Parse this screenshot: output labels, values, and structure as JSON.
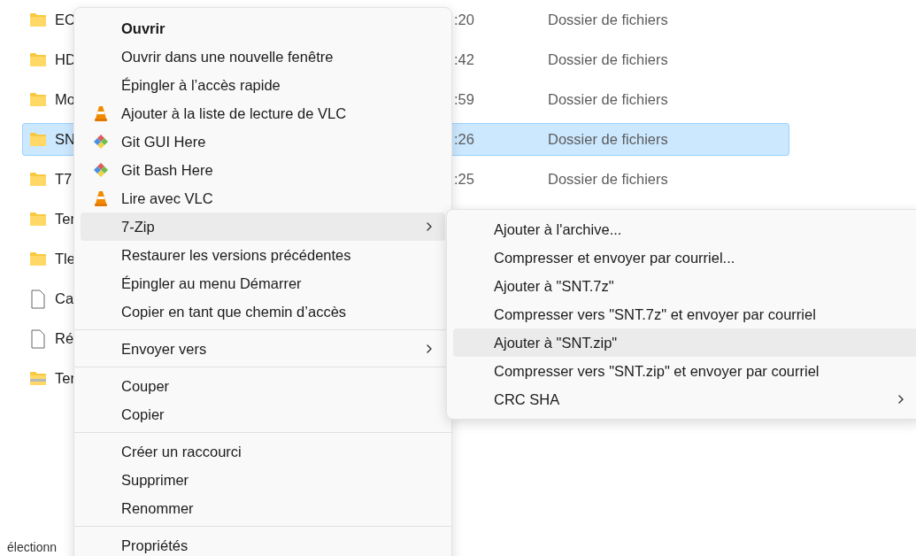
{
  "files": [
    {
      "name": "EC",
      "kind": "folder",
      "date": ":20",
      "type": "Dossier de fichiers",
      "selected": false
    },
    {
      "name": "HD",
      "kind": "folder",
      "date": ":42",
      "type": "Dossier de fichiers",
      "selected": false
    },
    {
      "name": "Mo",
      "kind": "folder",
      "date": ":59",
      "type": "Dossier de fichiers",
      "selected": false
    },
    {
      "name": "SN",
      "kind": "folder",
      "date": ":26",
      "type": "Dossier de fichiers",
      "selected": true
    },
    {
      "name": "T7",
      "kind": "folder",
      "date": ":25",
      "type": "Dossier de fichiers",
      "selected": false
    },
    {
      "name": "Ter",
      "kind": "folder",
      "selected": false
    },
    {
      "name": "Tle",
      "kind": "folder",
      "selected": false
    },
    {
      "name": "Ca",
      "kind": "file",
      "selected": false
    },
    {
      "name": "Ré",
      "kind": "file",
      "selected": false
    },
    {
      "name": "Ter",
      "kind": "zip",
      "selected": false
    }
  ],
  "status_bar": {
    "text": "électionn"
  },
  "context_menu": {
    "items": [
      {
        "kind": "plain",
        "label": "Ouvrir",
        "bold": true,
        "selected": false
      },
      {
        "kind": "plain",
        "label": "Ouvrir dans une nouvelle fenêtre",
        "selected": false
      },
      {
        "kind": "plain",
        "label": "Épingler à l’accès rapide",
        "selected": false
      },
      {
        "kind": "vlc",
        "label": "Ajouter à la liste de lecture de VLC",
        "selected": false
      },
      {
        "kind": "git",
        "label": "Git GUI Here",
        "selected": false
      },
      {
        "kind": "git",
        "label": "Git Bash Here",
        "selected": false
      },
      {
        "kind": "vlc",
        "label": "Lire avec VLC",
        "selected": false
      },
      {
        "kind": "plain",
        "label": "7-Zip",
        "submenu": true,
        "selected": true
      },
      {
        "kind": "plain",
        "label": "Restaurer les versions précédentes",
        "selected": false
      },
      {
        "kind": "plain",
        "label": "Épingler au menu Démarrer",
        "selected": false
      },
      {
        "kind": "plain",
        "label": "Copier en tant que chemin d’accès",
        "selected": false
      },
      {
        "kind": "separator"
      },
      {
        "kind": "plain",
        "label": "Envoyer vers",
        "submenu": true,
        "selected": false
      },
      {
        "kind": "separator"
      },
      {
        "kind": "plain",
        "label": "Couper",
        "selected": false
      },
      {
        "kind": "plain",
        "label": "Copier",
        "selected": false
      },
      {
        "kind": "separator"
      },
      {
        "kind": "plain",
        "label": "Créer un raccourci",
        "selected": false
      },
      {
        "kind": "plain",
        "label": "Supprimer",
        "selected": false
      },
      {
        "kind": "plain",
        "label": "Renommer",
        "selected": false
      },
      {
        "kind": "separator"
      },
      {
        "kind": "plain",
        "label": "Propriétés",
        "selected": false
      }
    ]
  },
  "submenu": {
    "items": [
      {
        "kind": "plain",
        "label": "Ajouter à l'archive...",
        "selected": false
      },
      {
        "kind": "plain",
        "label": "Compresser et envoyer par courriel...",
        "selected": false
      },
      {
        "kind": "plain",
        "label": "Ajouter à \"SNT.7z\"",
        "selected": false
      },
      {
        "kind": "plain",
        "label": "Compresser vers \"SNT.7z\" et envoyer par courriel",
        "selected": false
      },
      {
        "kind": "plain",
        "label": "Ajouter à \"SNT.zip\"",
        "selected": true
      },
      {
        "kind": "plain",
        "label": "Compresser vers \"SNT.zip\" et envoyer par courriel",
        "selected": false
      },
      {
        "kind": "plain",
        "label": "CRC SHA",
        "submenu": true,
        "selected": false
      }
    ]
  }
}
